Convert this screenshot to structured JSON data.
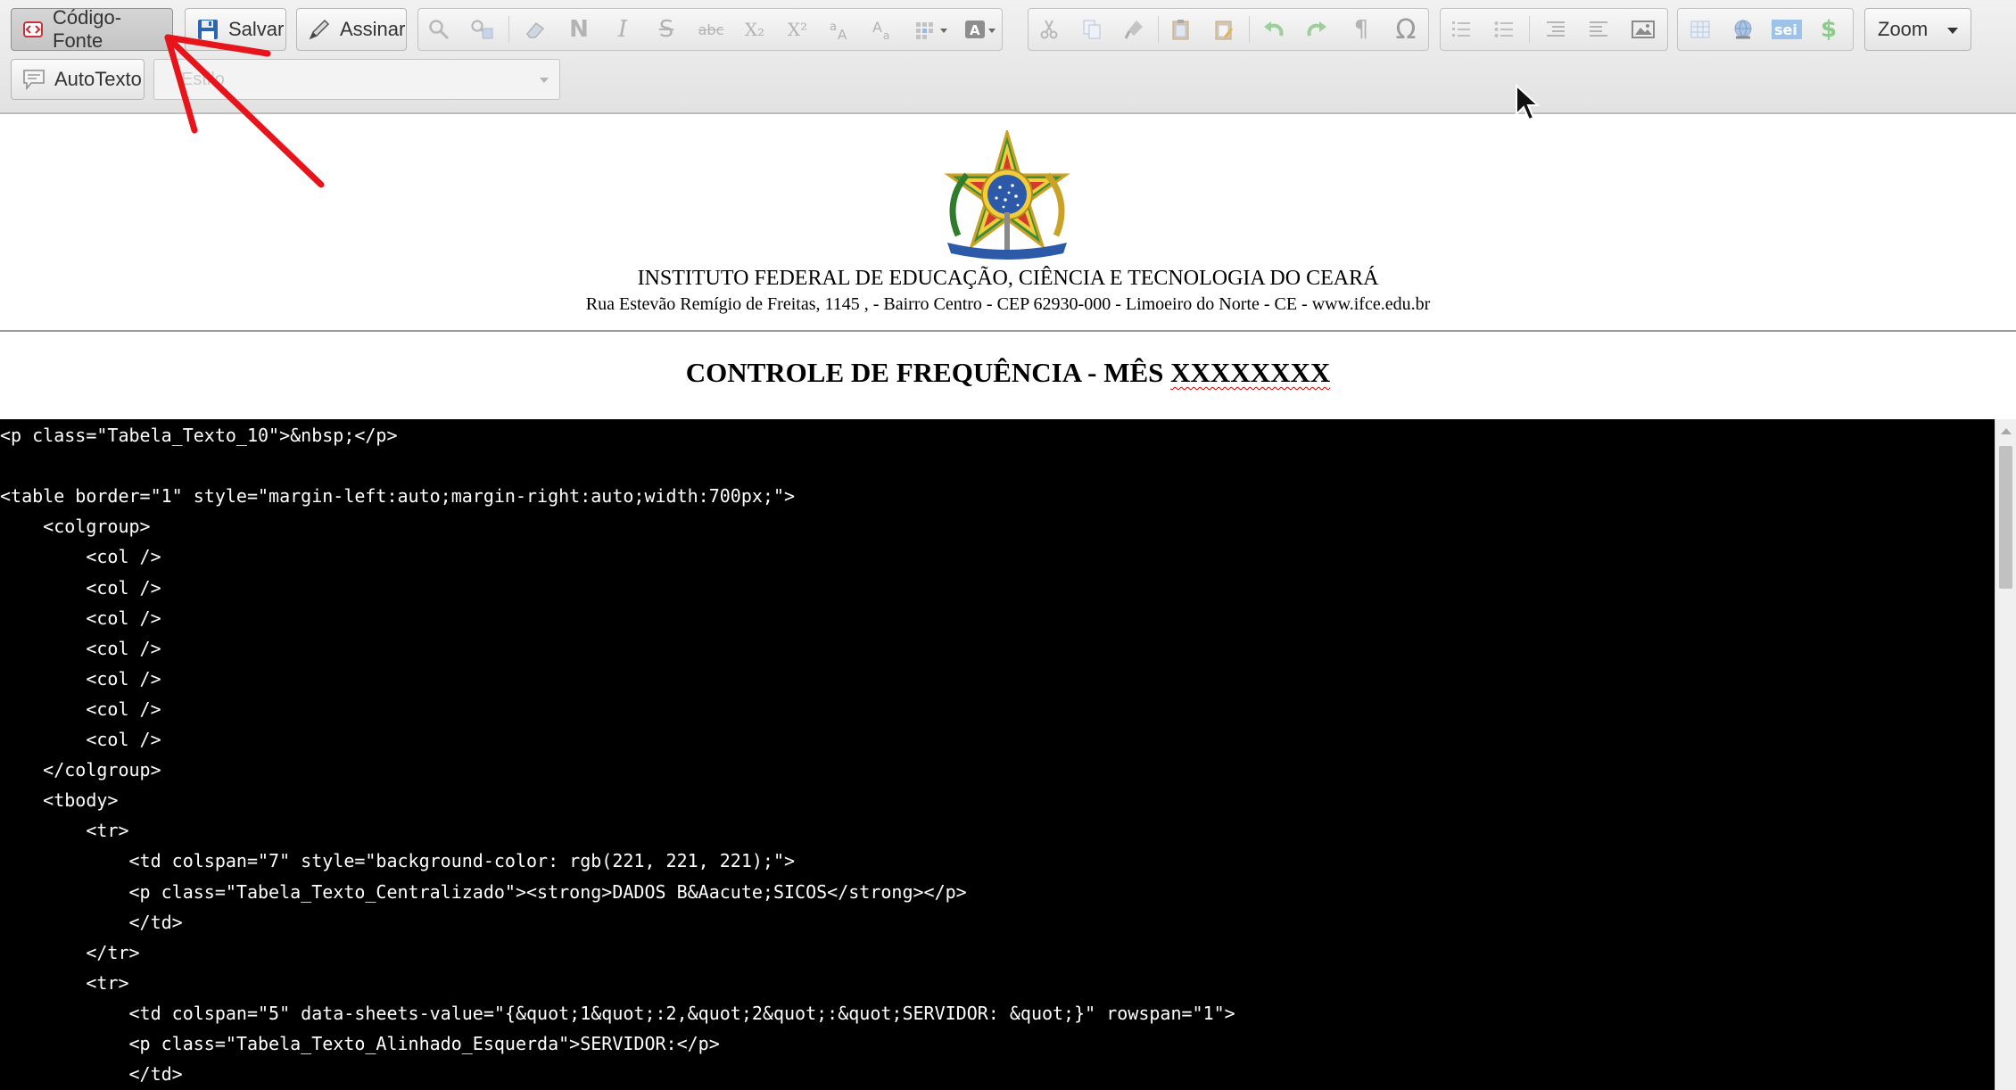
{
  "toolbar": {
    "source_button": "Código-Fonte",
    "save_button": "Salvar",
    "sign_button": "Assinar",
    "autotext_button": "AutoTexto",
    "style_select_value": "Estilo",
    "zoom_button": "Zoom",
    "format_icons": [
      "find-icon",
      "replace-icon",
      "remove-format-icon",
      "bold-icon",
      "italic-icon",
      "strikethrough-icon",
      "strike-abc-icon",
      "subscript-icon",
      "superscript-icon",
      "uppercase-icon",
      "lowercase-icon",
      "table-grid-icon",
      "text-color-icon"
    ],
    "edit_icons": [
      "cut-icon",
      "copy-icon",
      "paint-format-icon",
      "paste-icon",
      "paste-text-icon",
      "undo-icon",
      "redo-icon",
      "paragraph-icon",
      "omega-icon"
    ],
    "list_icons": [
      "numbered-list-icon",
      "bullet-list-icon",
      "outdent-icon",
      "indent-icon",
      "image-icon"
    ],
    "extra_icons": [
      "table-icon",
      "link-icon",
      "sei-icon",
      "money-icon"
    ],
    "glyphs": {
      "bold": "N",
      "italic": "I",
      "strike": "S",
      "strike_abc": "abc",
      "subscript": "X₂",
      "superscript": "X²",
      "paragraph": "¶",
      "omega": "Ω",
      "sei": "sei",
      "money": "$"
    }
  },
  "document": {
    "institution": "INSTITUTO FEDERAL DE EDUCAÇÃO, CIÊNCIA E TECNOLOGIA DO CEARÁ",
    "address": "Rua Estevão Remígio de Freitas, 1145 , - Bairro Centro - CEP 62930-000 - Limoeiro do Norte - CE - www.ifce.edu.br",
    "title_main": "CONTROLE DE FREQUÊNCIA - MÊS ",
    "title_placeholder": "XXXXXXXX"
  },
  "source_code": {
    "lines": [
      "<p class=\"Tabela_Texto_10\">&nbsp;</p>",
      "",
      "<table border=\"1\" style=\"margin-left:auto;margin-right:auto;width:700px;\">",
      "    <colgroup>",
      "        <col />",
      "        <col />",
      "        <col />",
      "        <col />",
      "        <col />",
      "        <col />",
      "        <col />",
      "    </colgroup>",
      "    <tbody>",
      "        <tr>",
      "            <td colspan=\"7\" style=\"background-color: rgb(221, 221, 221);\">",
      "            <p class=\"Tabela_Texto_Centralizado\"><strong>DADOS B&Aacute;SICOS</strong></p>",
      "            </td>",
      "        </tr>",
      "        <tr>",
      "            <td colspan=\"5\" data-sheets-value=\"{&quot;1&quot;:2,&quot;2&quot;:&quot;SERVIDOR: &quot;}\" rowspan=\"1\">",
      "            <p class=\"Tabela_Texto_Alinhado_Esquerda\">SERVIDOR:</p>",
      "            </td>"
    ]
  },
  "colors": {
    "annotation_arrow": "#e8141b",
    "code_background": "#000000",
    "code_text": "#ffffff",
    "spellcheck_underline": "#d40000"
  }
}
